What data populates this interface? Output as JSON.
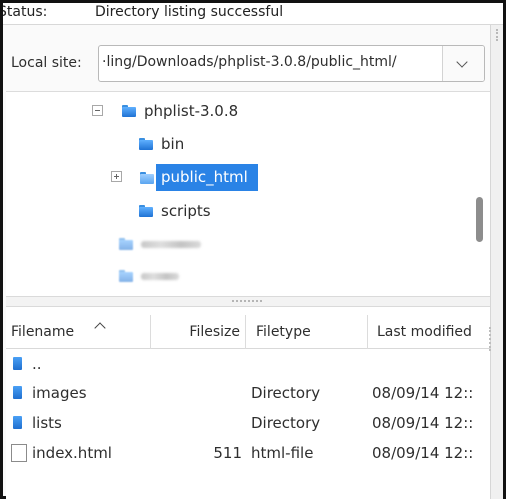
{
  "status": {
    "label": "Status:",
    "text": "Directory listing successful"
  },
  "local_site": {
    "label": "Local site:",
    "path": "·ling/Downloads/phplist-3.0.8/public_html/"
  },
  "tree": {
    "items": [
      {
        "label": "phplist-3.0.8",
        "expander": "minus",
        "icon": "folder-icon"
      },
      {
        "label": "bin",
        "icon": "folder-icon"
      },
      {
        "label": "public_html",
        "expander": "plus",
        "icon": "folder-open-icon",
        "selected": true
      },
      {
        "label": "scripts",
        "icon": "folder-icon"
      }
    ]
  },
  "file_list": {
    "columns": {
      "filename": "Filename",
      "filesize": "Filesize",
      "filetype": "Filetype",
      "modified": "Last modified"
    },
    "sort": {
      "column": "filename",
      "direction": "ascending"
    },
    "rows": [
      {
        "name": "..",
        "size": "",
        "type": "",
        "modified": "",
        "icon": "folder-icon"
      },
      {
        "name": "images",
        "size": "",
        "type": "Directory",
        "modified": "08/09/14 12::",
        "icon": "folder-icon"
      },
      {
        "name": "lists",
        "size": "",
        "type": "Directory",
        "modified": "08/09/14 12::",
        "icon": "folder-icon"
      },
      {
        "name": "index.html",
        "size": "511",
        "type": "html-file",
        "modified": "08/09/14 12::",
        "icon": "file-icon"
      }
    ]
  },
  "colors": {
    "selection": "#2a83e6",
    "folder": "#3a8fe0"
  }
}
